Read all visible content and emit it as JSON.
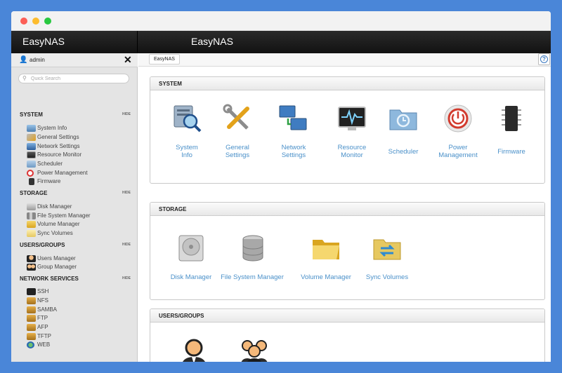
{
  "app_title": "EasyNAS",
  "main_title": "EasyNAS",
  "user": {
    "name": "admin"
  },
  "search": {
    "placeholder": "Quick Search"
  },
  "hide_label": "HIDE",
  "sidebar": {
    "sections": [
      {
        "title": "SYSTEM",
        "items": [
          "System Info",
          "General Settings",
          "Network Settings",
          "Resource Monitor",
          "Scheduler",
          "Power Management",
          "Firmware"
        ]
      },
      {
        "title": "STORAGE",
        "items": [
          "Disk Manager",
          "File System Manager",
          "Volume Manager",
          "Sync Volumes"
        ]
      },
      {
        "title": "USERS/GROUPS",
        "items": [
          "Users Manager",
          "Group Manager"
        ]
      },
      {
        "title": "NETWORK SERVICES",
        "items": [
          "SSH",
          "NFS",
          "SAMBA",
          "FTP",
          "AFP",
          "TFTP",
          "WEB"
        ]
      }
    ]
  },
  "tab_label": "EasyNAS",
  "help_label": "?",
  "panels": {
    "system": {
      "title": "SYSTEM",
      "tiles": [
        {
          "line1": "System",
          "line2": "Info"
        },
        {
          "line1": "General",
          "line2": "Settings"
        },
        {
          "line1": "Network",
          "line2": "Settings"
        },
        {
          "line1": "Resource",
          "line2": "Monitor"
        },
        {
          "line1": "Scheduler",
          "line2": ""
        },
        {
          "line1": "Power",
          "line2": "Management"
        },
        {
          "line1": "Firmware",
          "line2": ""
        }
      ]
    },
    "storage": {
      "title": "STORAGE",
      "tiles": [
        "Disk Manager",
        "File System Manager",
        "Volume Manager",
        "Sync Volumes"
      ]
    },
    "users": {
      "title": "USERS/GROUPS"
    }
  }
}
